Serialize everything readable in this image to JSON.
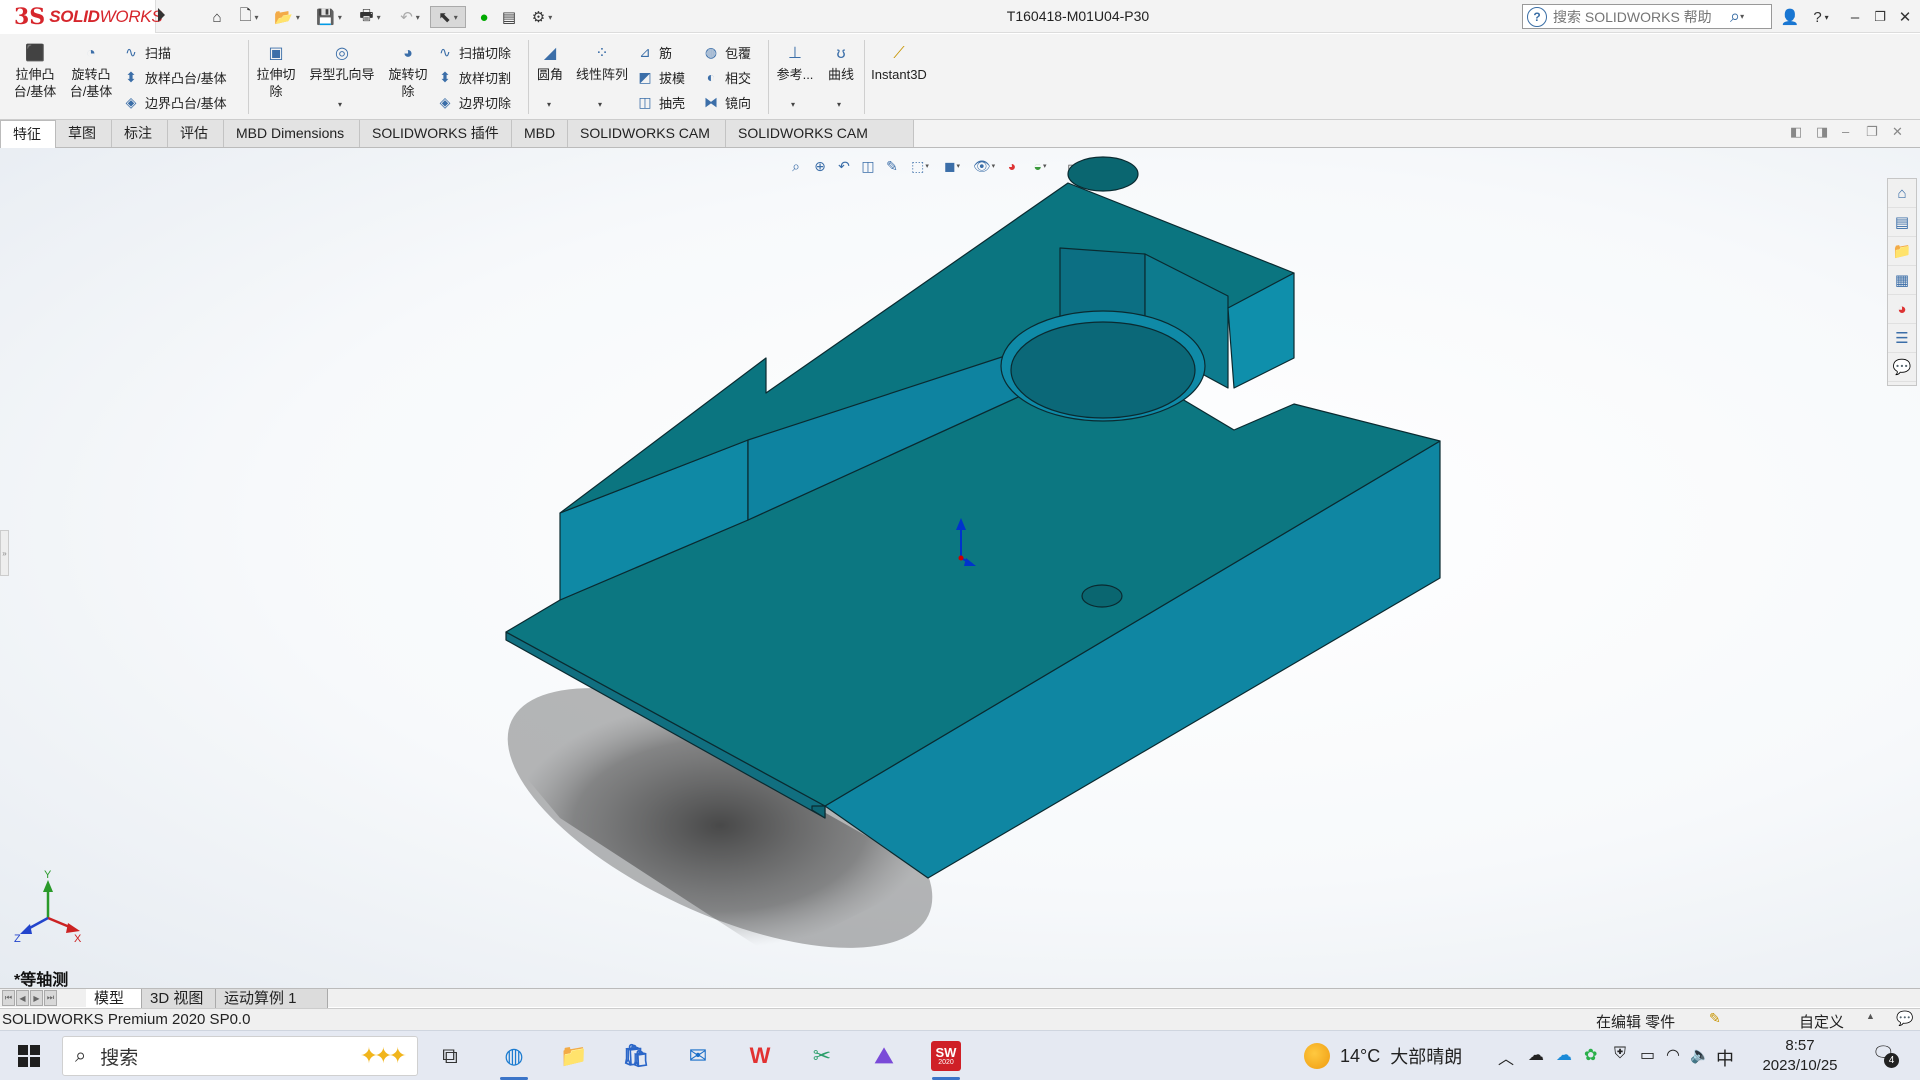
{
  "app": {
    "logo_ds": "3S",
    "logo_text_bold": "SOLID",
    "logo_text_light": "WORKS",
    "document_title": "T160418-M01U04-P30"
  },
  "help_search": {
    "placeholder": "搜索 SOLIDWORKS 帮助"
  },
  "command_manager": {
    "extrude_boss": [
      "拉伸凸",
      "台/基体"
    ],
    "revolve_boss": [
      "旋转凸",
      "台/基体"
    ],
    "sweep": "扫描",
    "loft": "放样凸台/基体",
    "boundary": "边界凸台/基体",
    "extrude_cut": [
      "拉伸切",
      "除"
    ],
    "hole_wizard": "异型孔向导",
    "revolve_cut": [
      "旋转切",
      "除"
    ],
    "swept_cut": "扫描切除",
    "lofted_cut": "放样切割",
    "boundary_cut": "边界切除",
    "fillet": "圆角",
    "linear_pattern": "线性阵列",
    "rib": "筋",
    "wrap": "包覆",
    "draft": "拔模",
    "intersect": "相交",
    "shell": "抽壳",
    "mirror": "镜向",
    "reference": "参考...",
    "curves": "曲线",
    "instant3d": "Instant3D"
  },
  "tabs": [
    "特征",
    "草图",
    "标注",
    "评估",
    "MBD Dimensions",
    "SOLIDWORKS 插件",
    "MBD",
    "SOLIDWORKS CAM",
    "SOLIDWORKS CAM TBM"
  ],
  "viewport": {
    "view_name": "*等轴测",
    "triad": {
      "x": "X",
      "y": "Y",
      "z": "Z"
    },
    "part_color": "#0e8aa6",
    "part_top_color": "#0c7780"
  },
  "model_tabs": [
    "模型",
    "3D 视图",
    "运动算例 1"
  ],
  "status": {
    "product": "SOLIDWORKS Premium 2020 SP0.0",
    "editing": "在编辑 零件",
    "units": "自定义"
  },
  "taskbar": {
    "search_placeholder": "搜索",
    "weather_temp": "14°C",
    "weather_text": "大部晴朗",
    "ime": "中",
    "time": "8:57",
    "date": "2023/10/25",
    "notification_count": "4",
    "sw_badge": "SW",
    "sw_year": "2020"
  }
}
